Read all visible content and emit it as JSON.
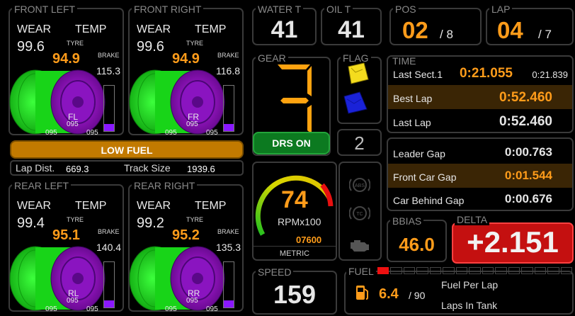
{
  "tyres": {
    "fl": {
      "title": "FRONT LEFT",
      "wear_label": "WEAR",
      "temp_label": "TEMP",
      "wear": "99.6",
      "tyre_label": "TYRE",
      "temp": "94.9",
      "brake_label": "BRAKE",
      "brake": "115.3",
      "pos": "FL",
      "p1": "095",
      "p0": "095",
      "p2": "095",
      "brake_fill": 0.15
    },
    "fr": {
      "title": "FRONT RIGHT",
      "wear_label": "WEAR",
      "temp_label": "TEMP",
      "wear": "99.6",
      "tyre_label": "TYRE",
      "temp": "94.9",
      "brake_label": "BRAKE",
      "brake": "116.8",
      "pos": "FR",
      "p1": "095",
      "p0": "095",
      "p2": "095",
      "brake_fill": 0.15
    },
    "rl": {
      "title": "REAR LEFT",
      "wear_label": "WEAR",
      "temp_label": "TEMP",
      "wear": "99.4",
      "tyre_label": "TYRE",
      "temp": "95.1",
      "brake_label": "BRAKE",
      "brake": "140.4",
      "pos": "RL",
      "p1": "095",
      "p0": "095",
      "p2": "095",
      "brake_fill": 0.15
    },
    "rr": {
      "title": "REAR RIGHT",
      "wear_label": "WEAR",
      "temp_label": "TEMP",
      "wear": "99.2",
      "tyre_label": "TYRE",
      "temp": "95.2",
      "brake_label": "BRAKE",
      "brake": "135.3",
      "pos": "RR",
      "p1": "095",
      "p0": "095",
      "p2": "095",
      "brake_fill": 0.15
    }
  },
  "low_fuel": "LOW FUEL",
  "lap_dist": {
    "label": "Lap Dist.",
    "value": "669.3"
  },
  "track_size": {
    "label": "Track Size",
    "value": "1939.6"
  },
  "water": {
    "title": "WATER T",
    "value": "41"
  },
  "oil": {
    "title": "OIL T",
    "value": "41"
  },
  "pos": {
    "title": "POS",
    "value": "02",
    "total": "/ 8"
  },
  "lap": {
    "title": "LAP",
    "value": "04",
    "total": "/ 7"
  },
  "gear": {
    "title": "GEAR",
    "value": "3",
    "drs": "DRS ON"
  },
  "flag": {
    "title": "FLAG",
    "count": "2"
  },
  "rpm": {
    "value": "74",
    "unit": "RPMx100",
    "max": "07600",
    "mode": "METRIC",
    "fraction": 0.92
  },
  "indicators": [
    "ABS",
    "TC",
    "engine"
  ],
  "speed": {
    "title": "SPEED",
    "value": "159"
  },
  "time": {
    "title": "TIME",
    "last_sect": {
      "label": "Last Sect.1",
      "value": "0:21.055",
      "value2": "0:21.839"
    },
    "best_lap": {
      "label": "Best Lap",
      "value": "0:52.460"
    },
    "last_lap": {
      "label": "Last Lap",
      "value": "0:52.460"
    }
  },
  "gaps": {
    "leader": {
      "label": "Leader Gap",
      "value": "0:00.763"
    },
    "front": {
      "label": "Front Car Gap",
      "value": "0:01.544"
    },
    "behind": {
      "label": "Car Behind Gap",
      "value": "0:00.676"
    }
  },
  "bbias": {
    "title": "BBIAS",
    "value": "46.0"
  },
  "delta": {
    "title": "DELTA",
    "value": "+2.151"
  },
  "fuel": {
    "title": "FUEL",
    "level_fraction": 0.07,
    "value": "6.4",
    "laps": "/ 90",
    "per_lap_label": "Fuel Per Lap",
    "laps_tank_label": "Laps In Tank"
  },
  "colors": {
    "accent": "#ff9c1a",
    "tyre_outer": "#19e619",
    "tyre_inner": "#a010d0",
    "delta_bg": "#c41010",
    "drs": "#0c7a20",
    "low_fuel": "#c27a00"
  }
}
